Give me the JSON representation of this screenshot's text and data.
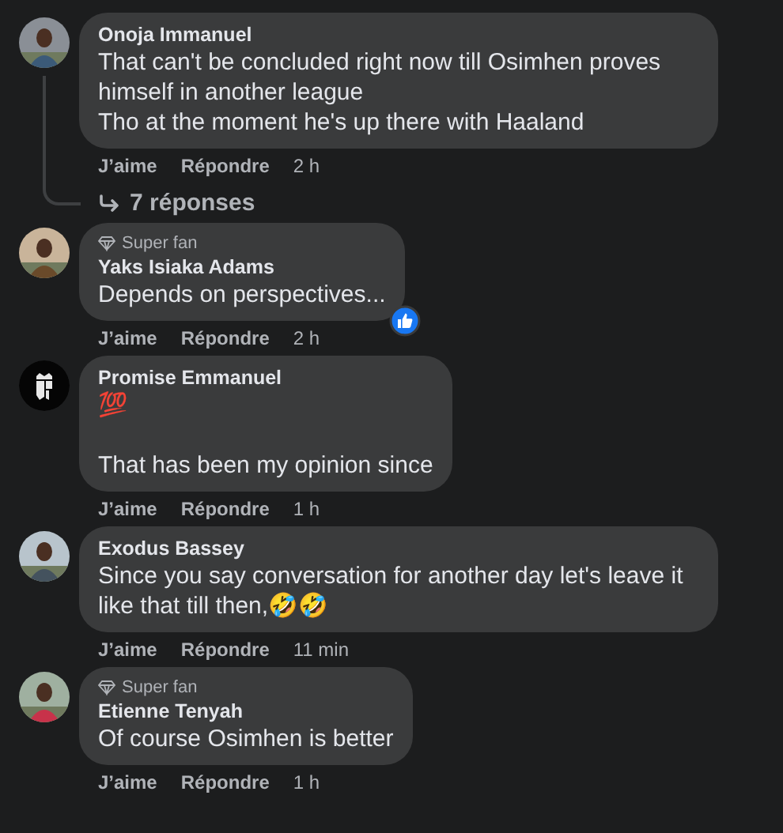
{
  "comments": [
    {
      "author": "Onoja Immanuel",
      "text": "That can't be concluded right now till Osimhen proves himself in another league\nTho at the moment he's up there with Haaland",
      "liked_reaction": false,
      "actions": {
        "like": "J’aime",
        "reply": "Répondre",
        "time": "2 h"
      },
      "replies": "7 réponses"
    },
    {
      "author": "Yaks Isiaka Adams",
      "badge": "Super fan",
      "text": "Depends on perspectives...",
      "liked_reaction": true,
      "actions": {
        "like": "J’aime",
        "reply": "Répondre",
        "time": "2 h"
      }
    },
    {
      "author": "Promise Emmanuel",
      "avatar": {
        "kind": "logo"
      },
      "text": "💯\n\nThat has been my opinion since",
      "liked_reaction": false,
      "actions": {
        "like": "J’aime",
        "reply": "Répondre",
        "time": "1 h"
      }
    },
    {
      "author": "Exodus Bassey",
      "text": "Since you say conversation for another day let's leave it like that till then,🤣🤣",
      "liked_reaction": false,
      "actions": {
        "like": "J’aime",
        "reply": "Répondre",
        "time": "11 min"
      }
    },
    {
      "author": "Etienne Tenyah",
      "badge": "Super fan",
      "text": "Of course Osimhen is better",
      "liked_reaction": false,
      "actions": {
        "like": "J’aime",
        "reply": "Répondre",
        "time": "1 h"
      }
    }
  ]
}
